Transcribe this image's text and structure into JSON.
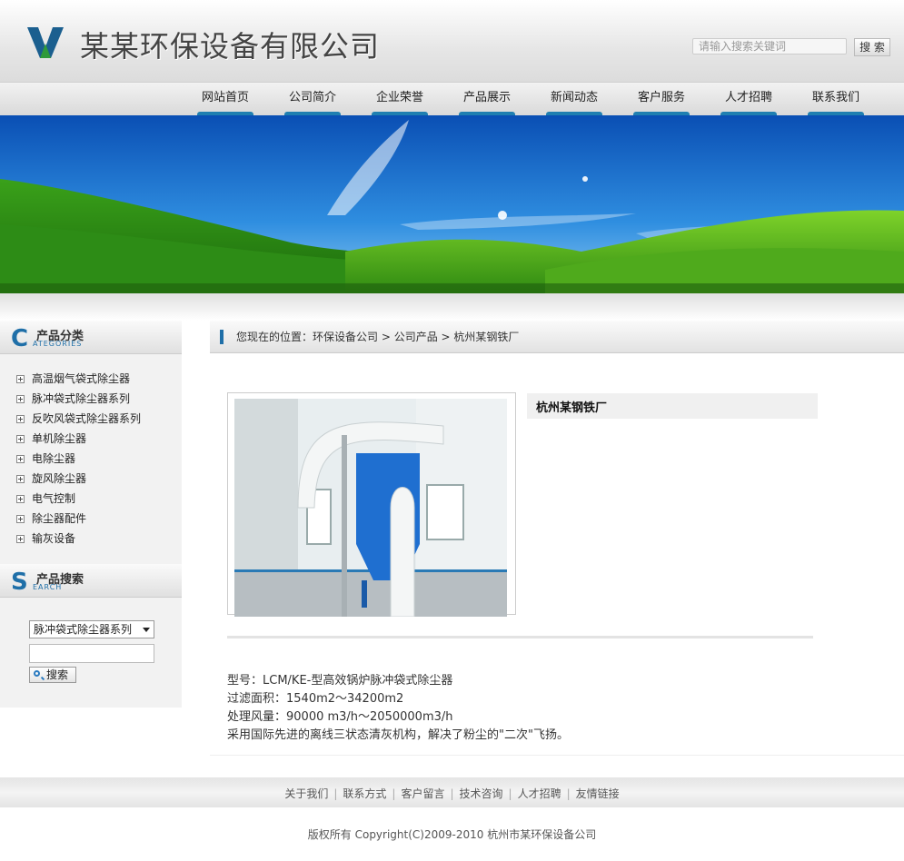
{
  "header": {
    "site_title": "某某环保设备有限公司",
    "search_placeholder": "请输入搜索关键词",
    "search_button": "搜 索"
  },
  "nav": {
    "items": [
      "网站首页",
      "公司简介",
      "企业荣誉",
      "产品展示",
      "新闻动态",
      "客户服务",
      "人才招聘",
      "联系我们"
    ],
    "accent_color": "#1f7fb1"
  },
  "sidebar": {
    "categories": {
      "title_letter": "C",
      "title": "产品分类",
      "subtitle": "ATEGORIES",
      "items": [
        "高温烟气袋式除尘器",
        "脉冲袋式除尘器系列",
        "反吹风袋式除尘器系列",
        "单机除尘器",
        "电除尘器",
        "旋风除尘器",
        "电气控制",
        "除尘器配件",
        "输灰设备"
      ]
    },
    "search": {
      "title_letter": "S",
      "title": "产品搜索",
      "subtitle": "EARCH",
      "selected_option": "脉冲袋式除尘器系列",
      "keyword_value": "",
      "button_label": "搜索"
    }
  },
  "breadcrumb": {
    "prefix": "您现在的位置：环保设备公司",
    "level1": "> 公司产品",
    "level2": "> 杭州某钢铁厂"
  },
  "product": {
    "title": "杭州某钢铁厂",
    "lines": [
      "型号：LCM/KE-型高效锅炉脉冲袋式除尘器",
      "过滤面积：1540m2～34200m2",
      "处理风量：90000 m3/h～2050000m3/h",
      "采用国际先进的离线三状态清灰机构，解决了粉尘的\"二次\"飞扬。"
    ]
  },
  "footer": {
    "links": [
      "关于我们",
      "联系方式",
      "客户留言",
      "技术咨询",
      "人才招聘",
      "友情链接"
    ],
    "copyright": "版权所有  Copyright(C)2009-2010 杭州市某环保设备公司"
  }
}
